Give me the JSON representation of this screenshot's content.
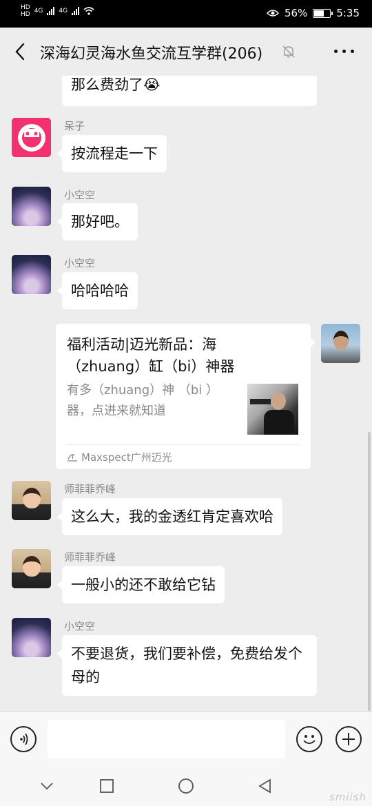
{
  "status_bar": {
    "sim1": "HD",
    "sim2": "HD",
    "net1": "4G",
    "net2": "4G",
    "battery": "56%",
    "battery_level": 0.56,
    "time": "5:35"
  },
  "header": {
    "title": "深海幻灵海水鱼交流互学群(206)",
    "icons": [
      "back-icon",
      "mute-bell-icon",
      "more-icon"
    ]
  },
  "messages": [
    {
      "text": "那么费劲了😭"
    },
    {
      "sender": "呆子",
      "text": "按流程走一下"
    },
    {
      "sender": "小空空",
      "text": "那好吧。"
    },
    {
      "sender": "小空空",
      "text": "哈哈哈哈"
    },
    {
      "type": "link-card",
      "title": "福利活动|迈光新品：海（zhuang）缸（bi）神器",
      "description": "有多（zhuang）神 （bi ）器，点进来就知道",
      "source": "Maxspect广州迈光"
    },
    {
      "sender": "师菲菲乔峰",
      "text": "这么大，我的金透红肯定喜欢哈"
    },
    {
      "sender": "师菲菲乔峰",
      "text": "一般小的还不敢给它钻"
    },
    {
      "sender": "小空空",
      "text": "不要退货，我们要补偿，免费给发个母的"
    }
  ],
  "input_bar": {
    "placeholder": "",
    "icons": [
      "voice-icon",
      "emoji-icon",
      "plus-icon"
    ]
  },
  "nav_bar": {
    "icons": [
      "nav-down-icon",
      "nav-recents-icon",
      "nav-home-icon",
      "nav-back-icon"
    ]
  },
  "watermark": "smiish"
}
